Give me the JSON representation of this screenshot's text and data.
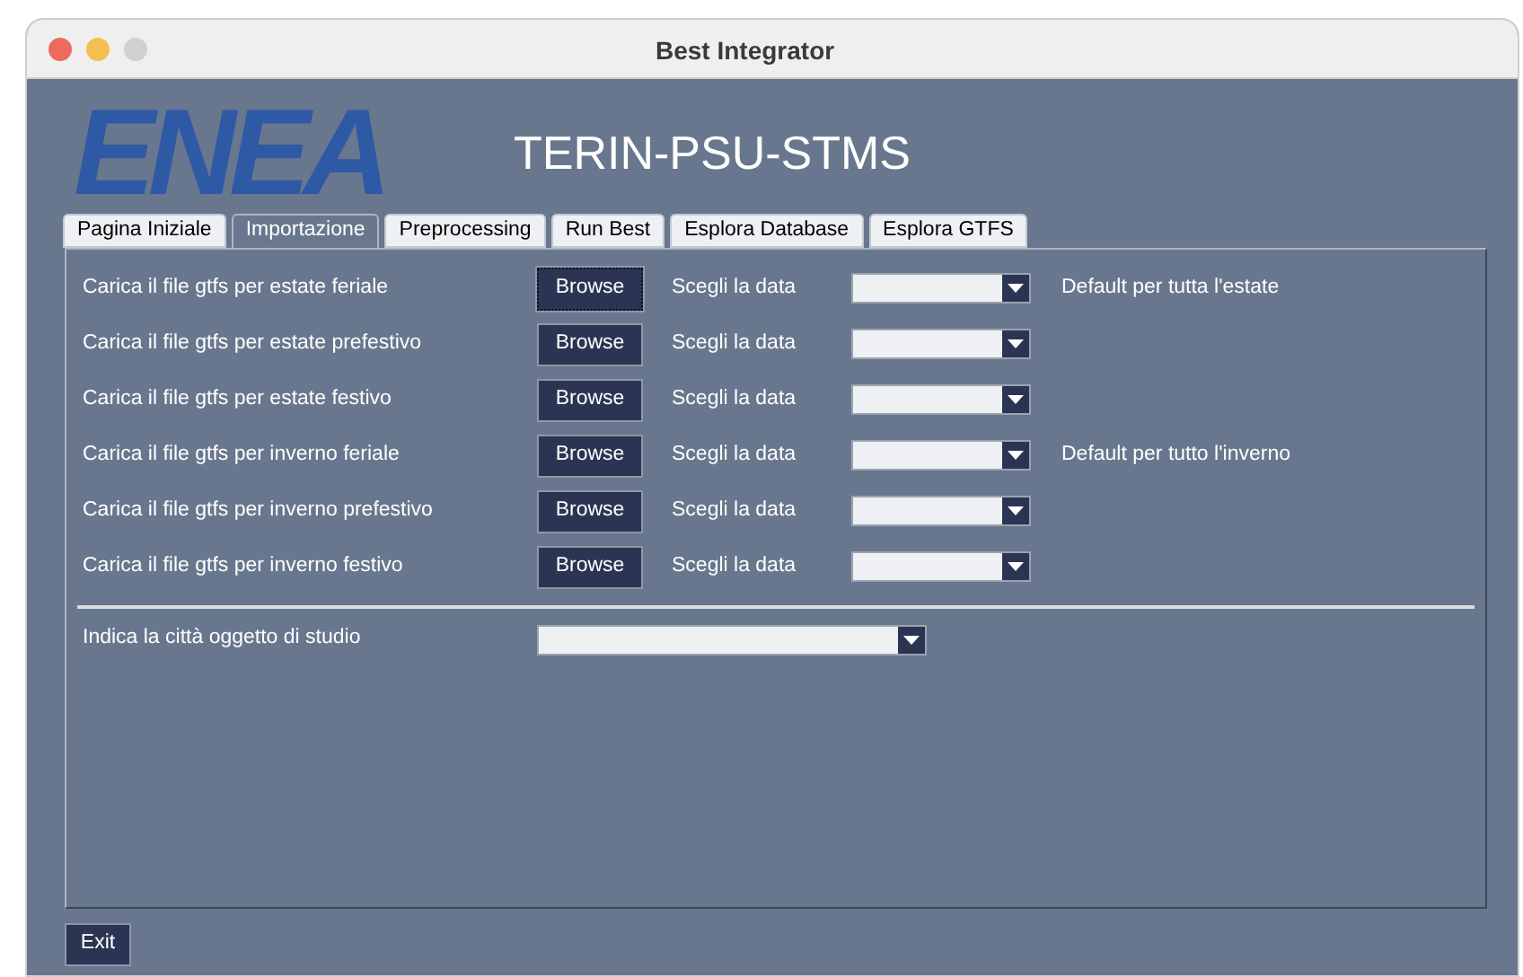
{
  "window": {
    "title": "Best Integrator"
  },
  "header": {
    "logo": "ENEA",
    "title": "TERIN-PSU-STMS"
  },
  "tabs": [
    {
      "label": "Pagina Iniziale",
      "selected": false
    },
    {
      "label": "Importazione",
      "selected": true
    },
    {
      "label": "Preprocessing",
      "selected": false
    },
    {
      "label": "Run Best",
      "selected": false
    },
    {
      "label": "Esplora Database",
      "selected": false
    },
    {
      "label": "Esplora GTFS",
      "selected": false
    }
  ],
  "rows": [
    {
      "label": "Carica il file gtfs per estate feriale",
      "button": "Browse",
      "focused": true,
      "date_label": "Scegli la data",
      "note": "Default per tutta l'estate"
    },
    {
      "label": "Carica il file gtfs per estate prefestivo",
      "button": "Browse",
      "focused": false,
      "date_label": "Scegli la data"
    },
    {
      "label": "Carica il file gtfs per estate festivo",
      "button": "Browse",
      "focused": false,
      "date_label": "Scegli la data"
    },
    {
      "label": "Carica il file gtfs per inverno feriale",
      "button": "Browse",
      "focused": false,
      "date_label": "Scegli la data",
      "note": "Default per tutto l'inverno"
    },
    {
      "label": "Carica il file gtfs per inverno prefestivo",
      "button": "Browse",
      "focused": false,
      "date_label": "Scegli la data"
    },
    {
      "label": "Carica il file gtfs per inverno festivo",
      "button": "Browse",
      "focused": false,
      "date_label": "Scegli la data"
    }
  ],
  "city": {
    "label": "Indica la città oggetto di studio"
  },
  "buttons": [
    "Exit"
  ]
}
